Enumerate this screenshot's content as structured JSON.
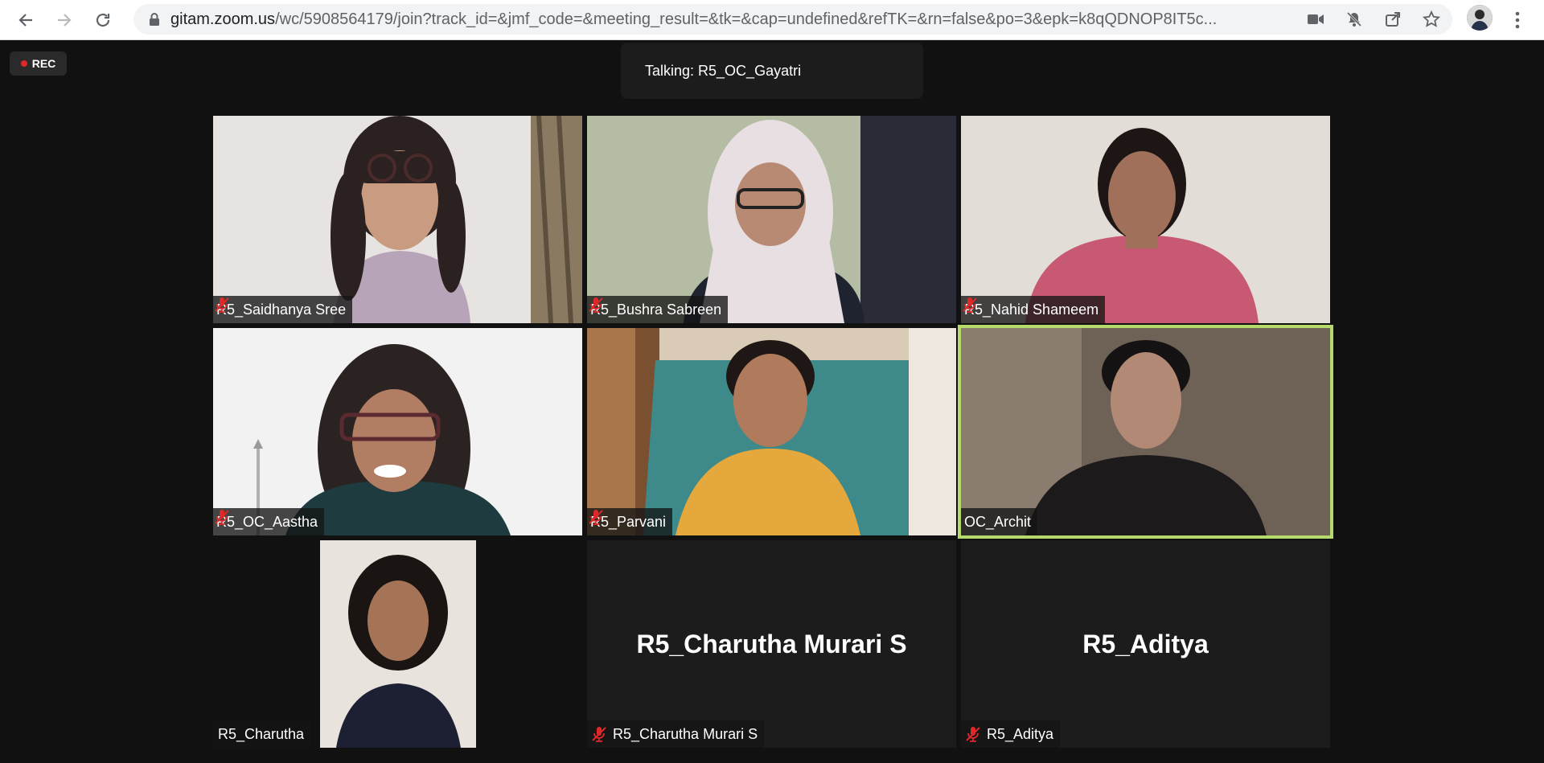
{
  "browser": {
    "url_host": "gitam.zoom.us",
    "url_path": "/wc/5908564179/join?track_id=&jmf_code=&meeting_result=&tk=&cap=undefined&refTK=&rn=false&po=3&epk=k8qQDNOP8IT5c..."
  },
  "meeting": {
    "rec_label": "REC",
    "talking": "Talking: R5_OC_Gayatri",
    "accent_color": "#b5d96a",
    "mute_color": "#e02828"
  },
  "participants": [
    {
      "name": "R5_Saidhanya Sree",
      "muted": true
    },
    {
      "name": "R5_Bushra Sabreen",
      "muted": true
    },
    {
      "name": "R5_Nahid Shameem",
      "muted": true
    },
    {
      "name": "R5_OC_Aastha",
      "muted": true
    },
    {
      "name": "R5_Parvani",
      "muted": true
    },
    {
      "name": "OC_Archit",
      "muted": false,
      "active_speaker": true
    },
    {
      "name": "R5_Charutha",
      "muted": false
    },
    {
      "name": "R5_Charutha Murari S",
      "muted": true,
      "video_off": true
    },
    {
      "name": "R5_Aditya",
      "muted": true,
      "video_off": true
    }
  ]
}
